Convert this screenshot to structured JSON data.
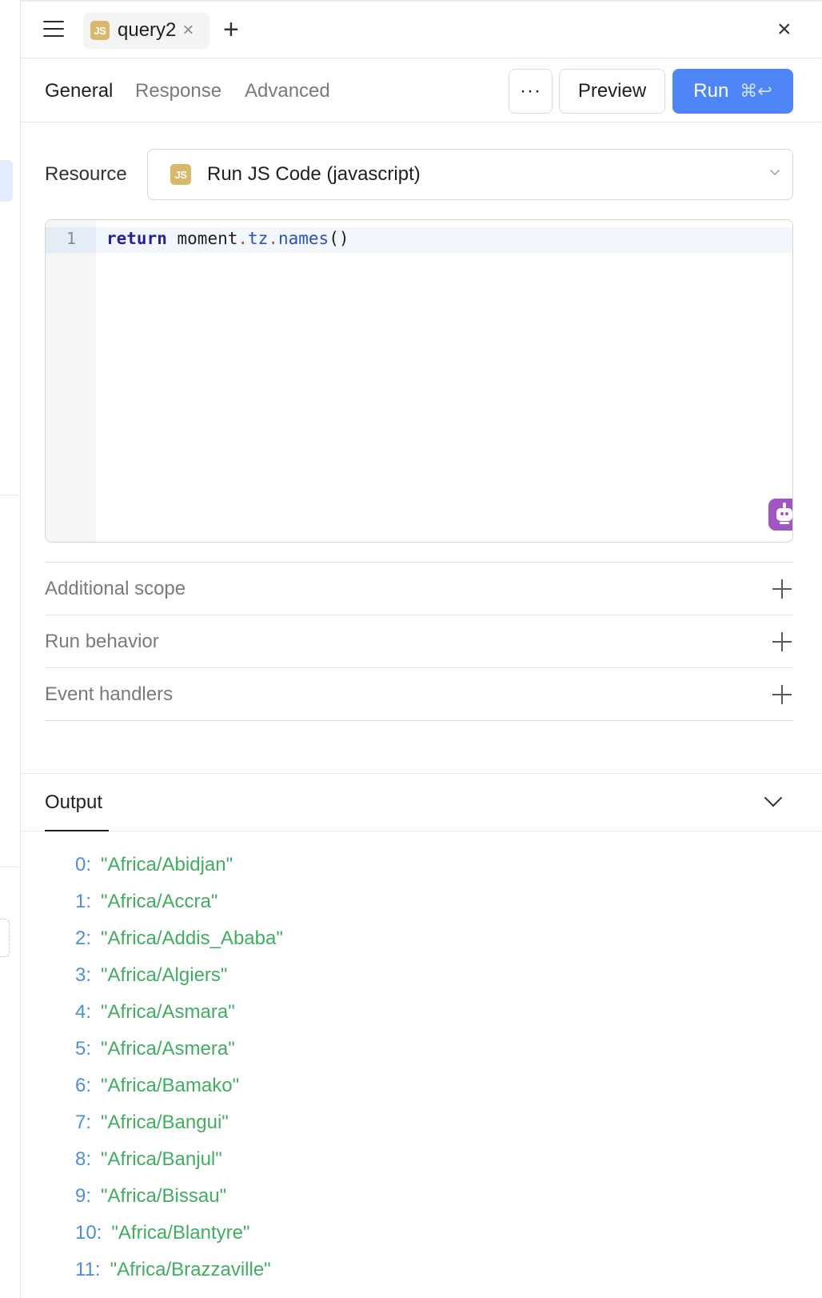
{
  "tabbar": {
    "tab_badge": "JS",
    "tab_name": "query2"
  },
  "subnav": {
    "tabs": [
      {
        "label": "General",
        "active": true
      },
      {
        "label": "Response",
        "active": false
      },
      {
        "label": "Advanced",
        "active": false
      }
    ],
    "more_label": "···",
    "preview_label": "Preview",
    "run_label": "Run",
    "run_shortcut": "⌘↩"
  },
  "resource": {
    "label": "Resource",
    "badge": "JS",
    "value": "Run JS Code (javascript)"
  },
  "editor": {
    "line_number": "1",
    "keyword": "return",
    "object": "moment",
    "dot": ".",
    "member": "tz",
    "method": "names",
    "parens": "()"
  },
  "sections": [
    {
      "label": "Additional scope"
    },
    {
      "label": "Run behavior"
    },
    {
      "label": "Event handlers"
    }
  ],
  "output": {
    "tab_label": "Output",
    "items": [
      {
        "index": "0:",
        "value": "\"Africa/Abidjan\""
      },
      {
        "index": "1:",
        "value": "\"Africa/Accra\""
      },
      {
        "index": "2:",
        "value": "\"Africa/Addis_Ababa\""
      },
      {
        "index": "3:",
        "value": "\"Africa/Algiers\""
      },
      {
        "index": "4:",
        "value": "\"Africa/Asmara\""
      },
      {
        "index": "5:",
        "value": "\"Africa/Asmera\""
      },
      {
        "index": "6:",
        "value": "\"Africa/Bamako\""
      },
      {
        "index": "7:",
        "value": "\"Africa/Bangui\""
      },
      {
        "index": "8:",
        "value": "\"Africa/Banjul\""
      },
      {
        "index": "9:",
        "value": "\"Africa/Bissau\""
      },
      {
        "index": "10:",
        "value": "\"Africa/Blantyre\""
      },
      {
        "index": "11:",
        "value": "\"Africa/Brazzaville\""
      }
    ]
  },
  "colors": {
    "accent": "#4f86f7",
    "js_badge": "#d9b869",
    "ai_button": "#a157c3",
    "output_index": "#4a90d9",
    "output_value": "#3fae5f"
  },
  "icons": [
    "hamburger-icon",
    "js-icon",
    "close-icon",
    "plus-icon",
    "chevron-down-icon",
    "robot-icon"
  ]
}
